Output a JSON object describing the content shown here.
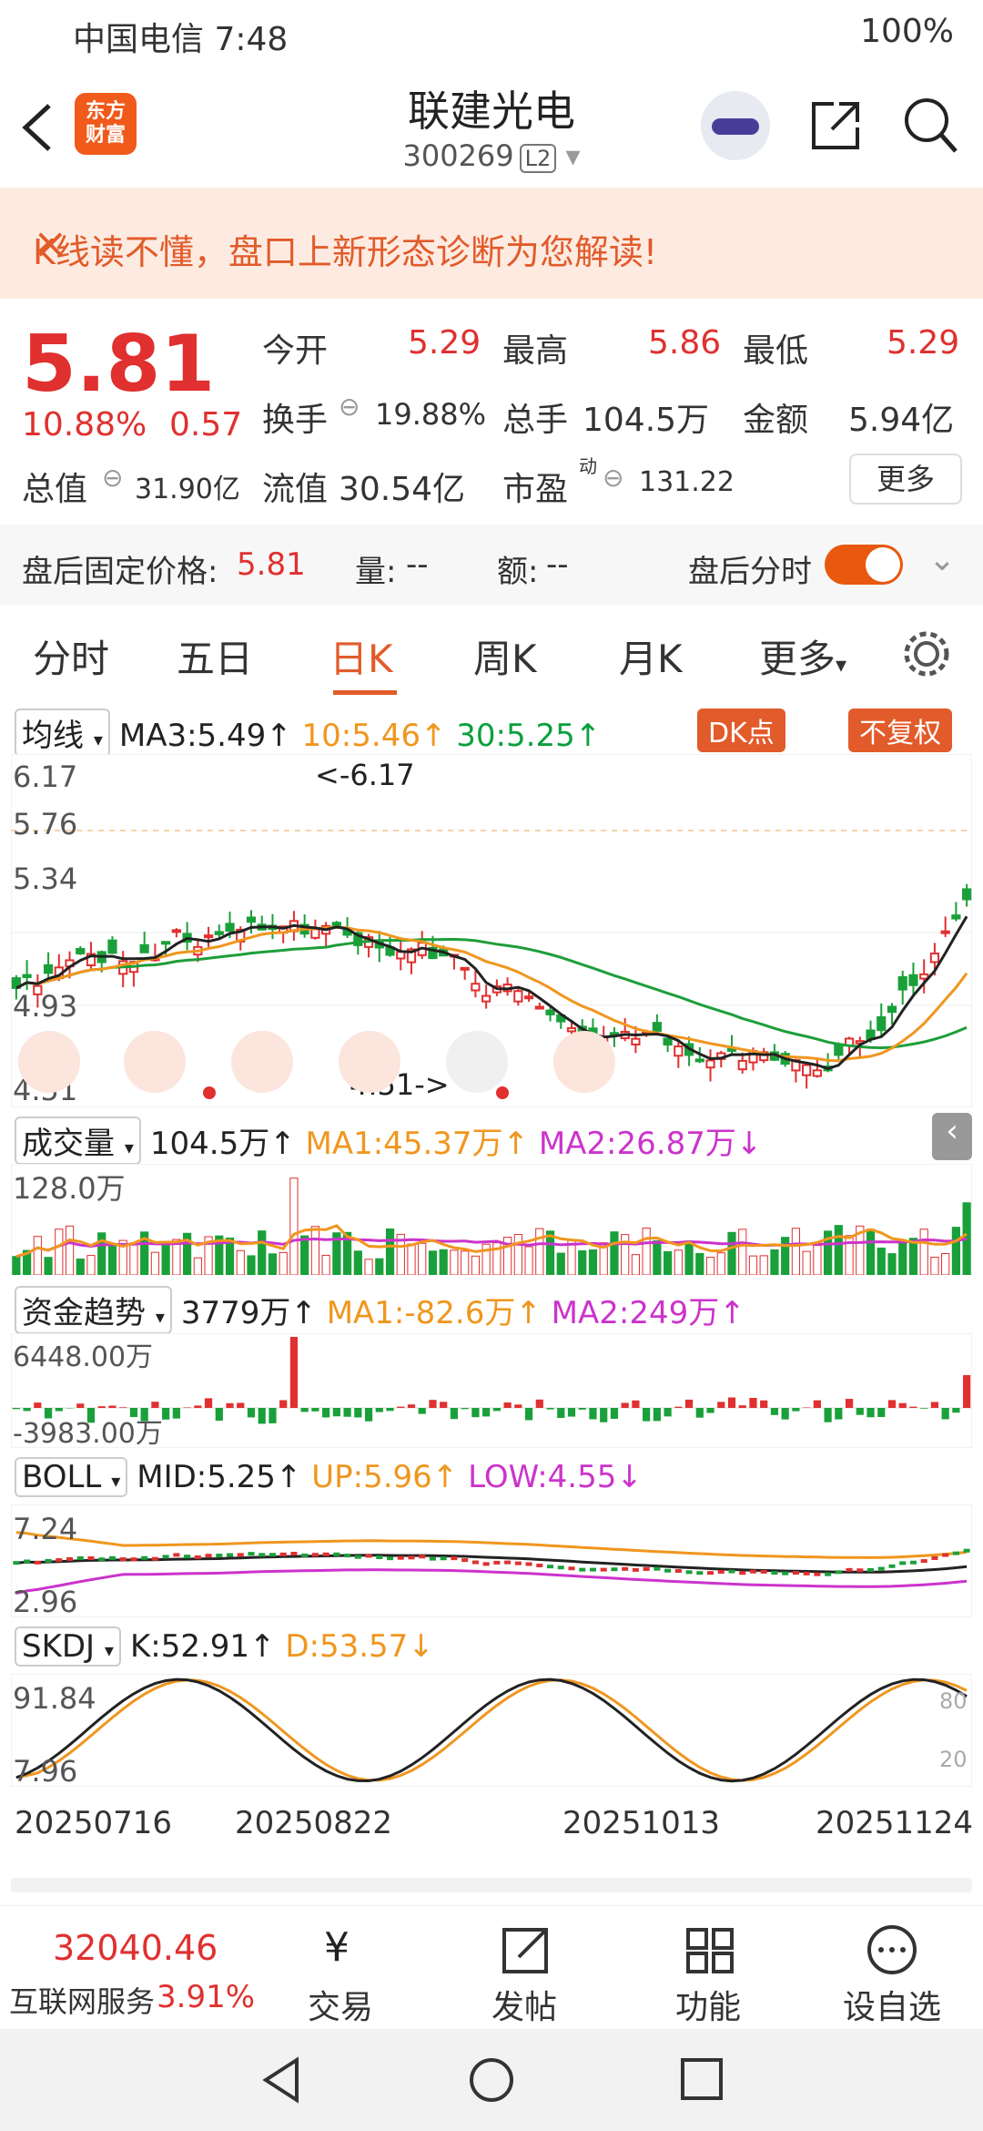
{
  "status": {
    "carrier": "中国电信 7:48",
    "battery": "100%"
  },
  "header": {
    "title": "联建光电",
    "code": "300269",
    "level": "L2",
    "logo": "东方\n财富"
  },
  "banner": {
    "text": "K线读不懂，盘口上新形态诊断为您解读!",
    "close": "×"
  },
  "quote": {
    "price": "5.81",
    "pct": "10.88%",
    "chg": "0.57",
    "open_label": "今开",
    "open": "5.29",
    "high_label": "最高",
    "high": "5.86",
    "low_label": "最低",
    "low": "5.29",
    "turnover_label": "换手",
    "turnover": "19.88%",
    "vol_label": "总手",
    "vol": "104.5万",
    "amt_label": "金额",
    "amt": "5.94亿",
    "mcap_label": "总值",
    "mcap": "31.90亿",
    "float_label": "流值",
    "float": "30.54亿",
    "pe_label": "市盈",
    "pe_sup": "动",
    "pe": "131.22",
    "more": "更多"
  },
  "afterhours": {
    "label": "盘后固定价格:",
    "price": "5.81",
    "vol_label": "量:",
    "vol": "--",
    "amt_label": "额:",
    "amt": "--",
    "fenshi": "盘后分时"
  },
  "tabs": [
    "分时",
    "五日",
    "日K",
    "周K",
    "月K",
    "更多"
  ],
  "ma": {
    "sel": "均线",
    "ma3": "MA3:5.49",
    "ma10": "10:5.46",
    "ma30": "30:5.25",
    "dk": "DK点",
    "fq": "不复权"
  },
  "kline": {
    "ticks": [
      "6.17",
      "5.76",
      "5.34",
      "4.93",
      "4.51"
    ],
    "hi_note": "<-6.17",
    "lo_note": "4.51->"
  },
  "volume": {
    "sel": "成交量",
    "val": "104.5万",
    "ma1": "MA1:45.37万",
    "ma2": "MA2:26.87万",
    "tick": "128.0万"
  },
  "capflow": {
    "sel": "资金趋势",
    "val": "3779万",
    "ma1": "MA1:-82.6万",
    "ma2": "MA2:249万",
    "t1": "6448.00万",
    "t2": "-3983.00万"
  },
  "boll": {
    "sel": "BOLL",
    "mid": "MID:5.25",
    "up": "UP:5.96",
    "low": "LOW:4.55",
    "t1": "7.24",
    "t2": "2.96"
  },
  "skdj": {
    "sel": "SKDJ",
    "k": "K:52.91",
    "d": "D:53.57",
    "t1": "91.84",
    "t2": "7.96",
    "r1": "80",
    "r2": "20"
  },
  "dates": [
    "20250716",
    "20250822",
    "20251013",
    "20251124"
  ],
  "footer": {
    "index": "32040.46",
    "sector": "互联网服务",
    "sector_pct": "3.91%",
    "b1": "交易",
    "b2": "发帖",
    "b3": "功能",
    "b4": "设自选"
  }
}
